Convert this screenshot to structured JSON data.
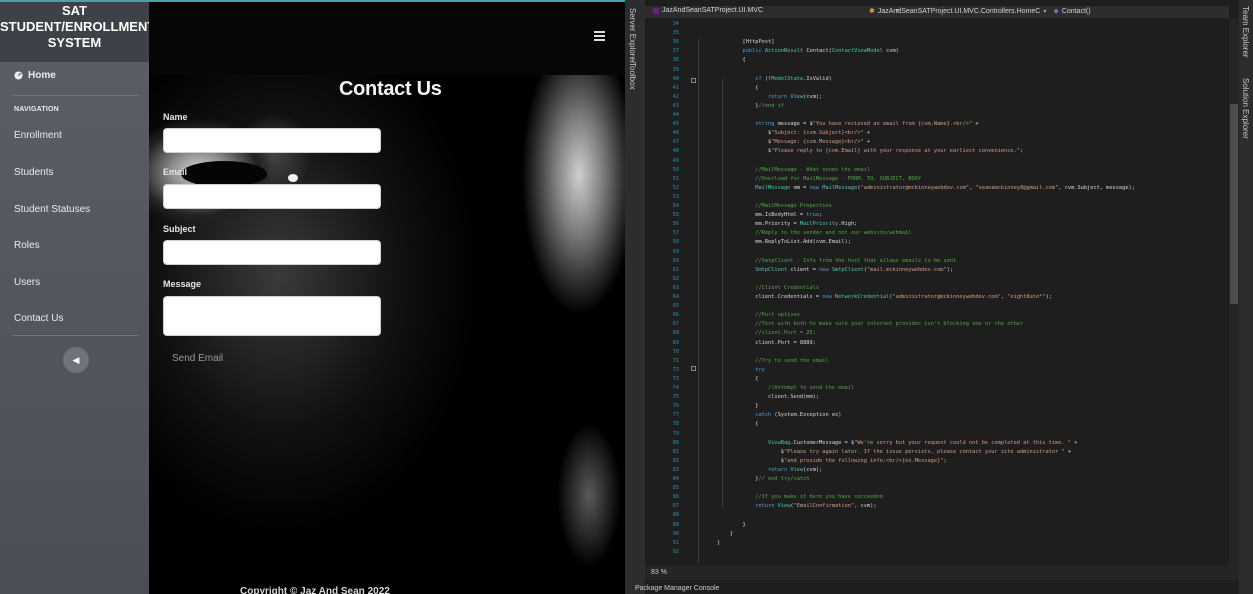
{
  "site": {
    "brand": [
      "SAT",
      "STUDENT/ENROLLMENT",
      "SYSTEM"
    ],
    "home_label": "Home",
    "nav_heading": "NAVIGATION",
    "nav_items": [
      "Enrollment",
      "Students",
      "Student Statuses",
      "Roles",
      "Users",
      "Contact Us"
    ],
    "page_title": "Contact Us",
    "form": {
      "name_label": "Name",
      "email_label": "Email",
      "subject_label": "Subject",
      "message_label": "Message",
      "send_label": "Send Email"
    },
    "copyright": "Copyright © Jaz And Sean 2022"
  },
  "ide": {
    "rail_tabs": [
      "Server Explorer",
      "Toolbox"
    ],
    "right_rail_tabs": [
      "Team Explorer",
      "Solution Explorer"
    ],
    "project_dropdown": "JazAndSeanSATProject.UI.MVC",
    "class_dropdown": "JazAndSeanSATProject.UI.MVC.Controllers.HomeC",
    "member_dropdown": "Contact()",
    "zoom": "83 %",
    "bottom_tab": "Package Manager Console",
    "first_line_number": 34,
    "code_lines": [
      "",
      "",
      "        [HttpPost]",
      "        public ActionResult Contact(ContactViewModel cvm)",
      "        {",
      "",
      "            if (!ModelState.IsValid)",
      "            {",
      "                return View(cvm);",
      "            }//end if",
      "",
      "            string message = $\"You have recieved an email from {cvm.Name}.<br/>\" +",
      "                $\"Subject: {cvm.Subject}<br/>\" +",
      "                $\"Message: {cvm.Message}<br/>\" +",
      "                $\"Please reply to {cvm.Email} with your response at your earliest convenience.\";",
      "",
      "            //MailMessage - What sends the email",
      "            //Overload for MailMessage - FORM, TO, SUBJECT, BODY",
      "            MailMessage mm = new MailMessage(\"administrator@mckinneywebdev.com\", \"seanamckinney8@gmail.com\", cvm.Subject, message);",
      "",
      "            //MailMessage Properties",
      "            mm.IsBodyHtml = true;",
      "            mm.Priority = MailPriority.High;",
      "            //Reply to the sender and not our website/webmail",
      "            mm.ReplyToList.Add(cvm.Email);",
      "",
      "            //SmtpClient - Info from the host that allows emails to be sent",
      "            SmtpClient client = new SmtpClient(\"mail.mckinneywebdev.com\");",
      "",
      "            //Client Credentials",
      "            client.Credentials = new NetworkCredential(\"administrator@mckinneywebdev.com\", \"eight8ate*\");",
      "",
      "            //Port options",
      "            //Test with both to make sure your internet provider isn't blocking one or the other",
      "            //client.Port = 25;",
      "            client.Port = 8889;",
      "",
      "            //Try to send the email",
      "            try",
      "            {",
      "                //Attempt to send the email",
      "                client.Send(mm);",
      "            }",
      "            catch (System.Exception ex)",
      "            {",
      "",
      "                ViewBag.CustomerMessage = $\"We're sorry but your request could not be completed at this time. \" +",
      "                    $\"Please try again later. If the issue persists, please contact your site administrator \" +",
      "                    $\"and provide the following info:<br/>{ex.Message}\";",
      "                return View(cvm);",
      "            }// end try/catch",
      "",
      "            //If you make it here you have succeeded",
      "            return View(\"EmailConfirmation\", cvm);",
      "",
      "        }",
      "    }",
      "}",
      ""
    ],
    "colors": {
      "keyword": "#569cd6",
      "type": "#4ec9b0",
      "string": "#d69d85",
      "comment": "#57a64a",
      "line_number": "#2b91af"
    }
  }
}
